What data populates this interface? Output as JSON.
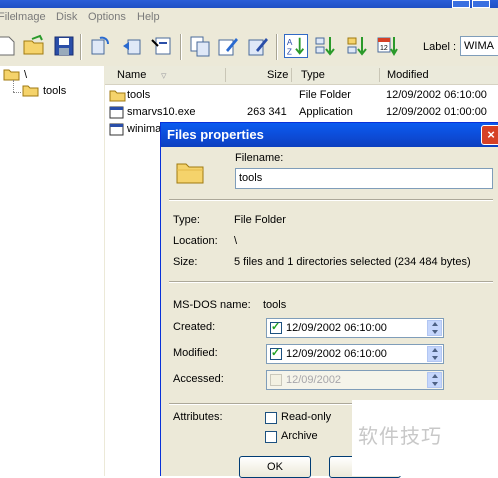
{
  "menu": [
    "File",
    "Image",
    "Disk",
    "Options",
    "Help"
  ],
  "toolbar": {
    "label_text": "Label :",
    "label_value": "WIMA"
  },
  "tree": {
    "root": "\\",
    "child": "tools"
  },
  "list": {
    "columns": [
      "Name",
      "Size",
      "Type",
      "Modified"
    ],
    "rows": [
      {
        "name": "tools",
        "size": "",
        "type": "File Folder",
        "modified": "12/09/2002 06:10:00"
      },
      {
        "name": "smarvs10.exe",
        "size": "263 341",
        "type": "Application",
        "modified": "12/09/2002 01:00:00"
      },
      {
        "name": "winima",
        "size": "",
        "type": "",
        "modified": ""
      }
    ]
  },
  "dialog": {
    "title": "Files properties",
    "filename_label": "Filename:",
    "filename_value": "tools",
    "type_label": "Type:",
    "type_value": "File Folder",
    "location_label": "Location:",
    "location_value": "\\",
    "size_label": "Size:",
    "size_value": "5 files and 1 directories selected (234 484 bytes)",
    "msdos_label": "MS-DOS name:",
    "msdos_value": "tools",
    "created_label": "Created:",
    "created_value": "12/09/2002 06:10:00",
    "modified_label": "Modified:",
    "modified_value": "12/09/2002 06:10:00",
    "accessed_label": "Accessed:",
    "accessed_value": "12/09/2002",
    "attributes_label": "Attributes:",
    "readonly_label": "Read-only",
    "archive_label": "Archive",
    "ok_label": "OK",
    "close_glyph": "×"
  },
  "watermark": "软件技巧",
  "colors": {
    "dialog_title": "#0a5bf0",
    "folder": "#f5d36b",
    "window_bg": "#ece9d8"
  }
}
